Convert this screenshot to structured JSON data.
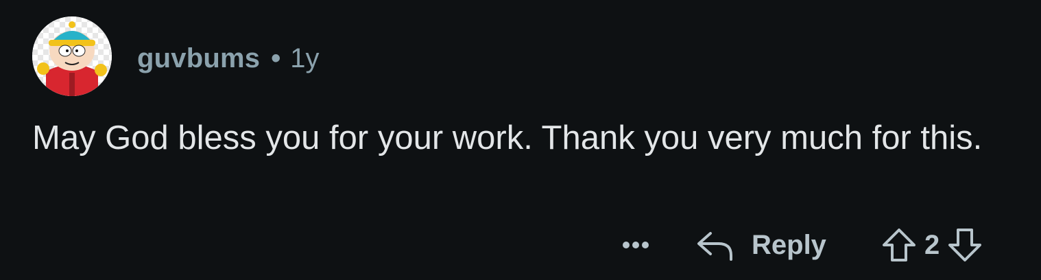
{
  "comment": {
    "username": "guvbums",
    "separator": "•",
    "age": "1y",
    "text": "May God bless you for your work. Thank you very much for this.",
    "avatar_icon": "cartman-avatar"
  },
  "actions": {
    "more_icon": "ellipsis-icon",
    "reply_icon": "reply-arrow-icon",
    "reply_label": "Reply",
    "upvote_icon": "upvote-arrow-icon",
    "score": "2",
    "downvote_icon": "downvote-arrow-icon"
  },
  "colors": {
    "background": "#0e1113",
    "meta_text": "#8ba2ad",
    "body_text": "#e3e6e8",
    "action_text": "#b8c5cc"
  }
}
